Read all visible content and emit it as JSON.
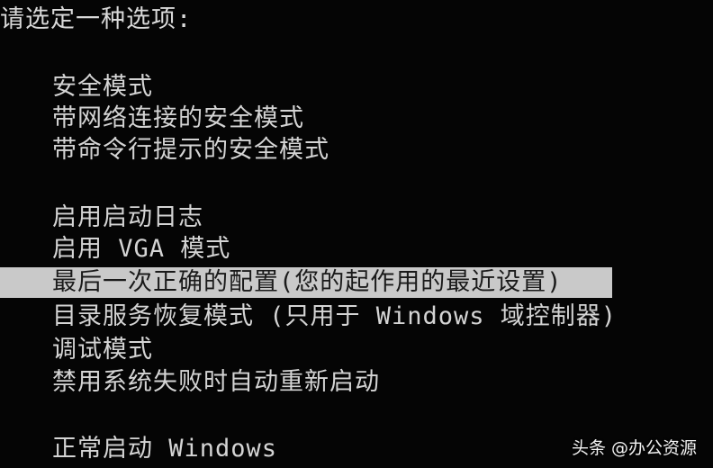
{
  "prompt": "请选定一种选项:",
  "menu": {
    "group1": [
      "安全模式",
      "带网络连接的安全模式",
      "带命令行提示的安全模式"
    ],
    "group2": [
      "启用启动日志",
      "启用 VGA 模式",
      "最后一次正确的配置(您的起作用的最近设置)",
      "目录服务恢复模式 (只用于 Windows 域控制器)",
      "调试模式",
      "禁用系统失败时自动重新启动"
    ],
    "group3": [
      "正常启动 Windows"
    ],
    "selected": "最后一次正确的配置(您的起作用的最近设置)"
  },
  "watermark": "头条 @办公资源",
  "colors": {
    "background": "#050505",
    "text": "#d4d4d4",
    "highlight": "#c9c9c9",
    "highlight_text": "#1a1a1a"
  }
}
